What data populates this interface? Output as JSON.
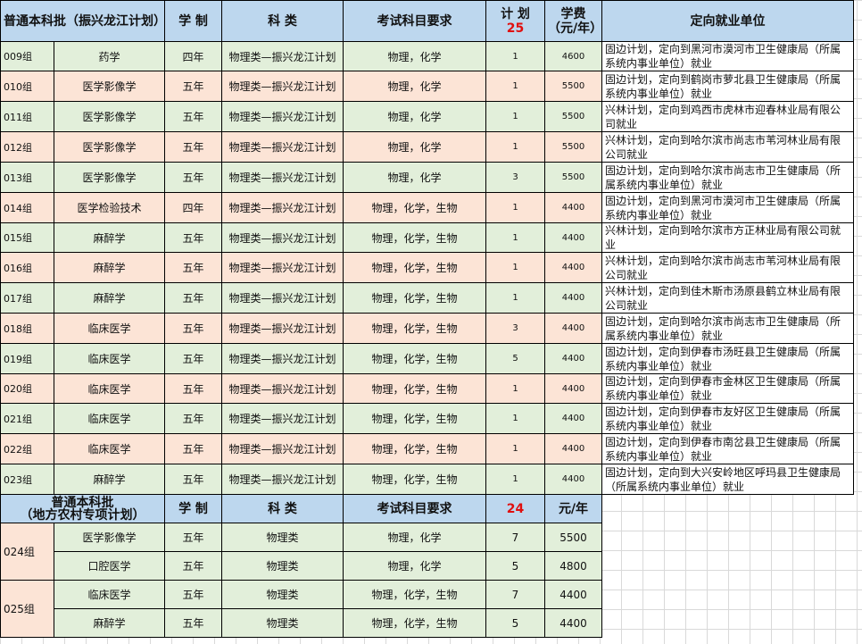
{
  "sheet": {
    "header": {
      "batch": "普通本科批（振兴龙江计划）",
      "duration": "学  制",
      "category": "科   类",
      "subjects": "考试科目要求",
      "plan": "计  划",
      "plan_total": "25",
      "tuition": "学费（元/年）",
      "employer": "定向就业单位"
    },
    "rows": [
      {
        "group": "009组",
        "major": "药学",
        "years": "四年",
        "category": "物理类—振兴龙江计划",
        "subjects": "物理，化学",
        "plan": "1",
        "fee": "4600",
        "employer": "固边计划，定向到黑河市漠河市卫生健康局（所属系统内事业单位）就业"
      },
      {
        "group": "010组",
        "major": "医学影像学",
        "years": "五年",
        "category": "物理类—振兴龙江计划",
        "subjects": "物理，化学",
        "plan": "1",
        "fee": "5500",
        "employer": "固边计划，定向到鹤岗市萝北县卫生健康局（所属系统内事业单位）就业"
      },
      {
        "group": "011组",
        "major": "医学影像学",
        "years": "五年",
        "category": "物理类—振兴龙江计划",
        "subjects": "物理，化学",
        "plan": "1",
        "fee": "5500",
        "employer": "兴林计划，定向到鸡西市虎林市迎春林业局有限公司就业"
      },
      {
        "group": "012组",
        "major": "医学影像学",
        "years": "五年",
        "category": "物理类—振兴龙江计划",
        "subjects": "物理，化学",
        "plan": "1",
        "fee": "5500",
        "employer": "兴林计划，定向到哈尔滨市尚志市苇河林业局有限公司就业"
      },
      {
        "group": "013组",
        "major": "医学影像学",
        "years": "五年",
        "category": "物理类—振兴龙江计划",
        "subjects": "物理，化学",
        "plan": "3",
        "fee": "5500",
        "employer": "固边计划，定向到哈尔滨市尚志市卫生健康局（所属系统内事业单位）就业"
      },
      {
        "group": "014组",
        "major": "医学检验技术",
        "years": "四年",
        "category": "物理类—振兴龙江计划",
        "subjects": "物理，化学，生物",
        "plan": "1",
        "fee": "4400",
        "employer": "固边计划，定向到黑河市漠河市卫生健康局（所属系统内事业单位）就业"
      },
      {
        "group": "015组",
        "major": "麻醉学",
        "years": "五年",
        "category": "物理类—振兴龙江计划",
        "subjects": "物理，化学，生物",
        "plan": "1",
        "fee": "4400",
        "employer": "兴林计划，定向到哈尔滨市方正林业局有限公司就业"
      },
      {
        "group": "016组",
        "major": "麻醉学",
        "years": "五年",
        "category": "物理类—振兴龙江计划",
        "subjects": "物理，化学，生物",
        "plan": "1",
        "fee": "4400",
        "employer": "兴林计划，定向到哈尔滨市尚志市苇河林业局有限公司就业"
      },
      {
        "group": "017组",
        "major": "麻醉学",
        "years": "五年",
        "category": "物理类—振兴龙江计划",
        "subjects": "物理，化学，生物",
        "plan": "1",
        "fee": "4400",
        "employer": "兴林计划，定向到佳木斯市汤原县鹤立林业局有限公司就业"
      },
      {
        "group": "018组",
        "major": "临床医学",
        "years": "五年",
        "category": "物理类—振兴龙江计划",
        "subjects": "物理，化学，生物",
        "plan": "3",
        "fee": "4400",
        "employer": "固边计划，定向到哈尔滨市尚志市卫生健康局（所属系统内事业单位）就业"
      },
      {
        "group": "019组",
        "major": "临床医学",
        "years": "五年",
        "category": "物理类—振兴龙江计划",
        "subjects": "物理，化学，生物",
        "plan": "5",
        "fee": "4400",
        "employer": "固边计划，定向到伊春市汤旺县卫生健康局（所属系统内事业单位）就业"
      },
      {
        "group": "020组",
        "major": "临床医学",
        "years": "五年",
        "category": "物理类—振兴龙江计划",
        "subjects": "物理，化学，生物",
        "plan": "1",
        "fee": "4400",
        "employer": "固边计划，定向到伊春市金林区卫生健康局（所属系统内事业单位）就业"
      },
      {
        "group": "021组",
        "major": "临床医学",
        "years": "五年",
        "category": "物理类—振兴龙江计划",
        "subjects": "物理，化学，生物",
        "plan": "1",
        "fee": "4400",
        "employer": "固边计划，定向到伊春市友好区卫生健康局（所属系统内事业单位）就业"
      },
      {
        "group": "022组",
        "major": "临床医学",
        "years": "五年",
        "category": "物理类—振兴龙江计划",
        "subjects": "物理，化学，生物",
        "plan": "1",
        "fee": "4400",
        "employer": "固边计划，定向到伊春市南岔县卫生健康局（所属系统内事业单位）就业"
      },
      {
        "group": "023组",
        "major": "麻醉学",
        "years": "五年",
        "category": "物理类—振兴龙江计划",
        "subjects": "物理，化学，生物",
        "plan": "1",
        "fee": "4400",
        "employer": "固边计划，定向到大兴安岭地区呼玛县卫生健康局（所属系统内事业单位）就业"
      }
    ],
    "header2": {
      "batch": "普通本科批",
      "batch_sub": "（地方农村专项计划）",
      "duration": "学  制",
      "category": "科  类",
      "subjects": "考试科目要求",
      "plan_total": "24",
      "tuition": "元/年"
    },
    "rows2": [
      {
        "group": "024组",
        "items": [
          {
            "major": "医学影像学",
            "years": "五年",
            "category": "物理类",
            "subjects": "物理，化学",
            "plan": "7",
            "fee": "5500"
          },
          {
            "major": "口腔医学",
            "years": "五年",
            "category": "物理类",
            "subjects": "物理，化学",
            "plan": "5",
            "fee": "4800"
          }
        ]
      },
      {
        "group": "025组",
        "items": [
          {
            "major": "临床医学",
            "years": "五年",
            "category": "物理类",
            "subjects": "物理，化学，生物",
            "plan": "7",
            "fee": "4400"
          },
          {
            "major": "麻醉学",
            "years": "五年",
            "category": "物理类",
            "subjects": "物理，化学，生物",
            "plan": "5",
            "fee": "4400"
          }
        ]
      }
    ]
  }
}
